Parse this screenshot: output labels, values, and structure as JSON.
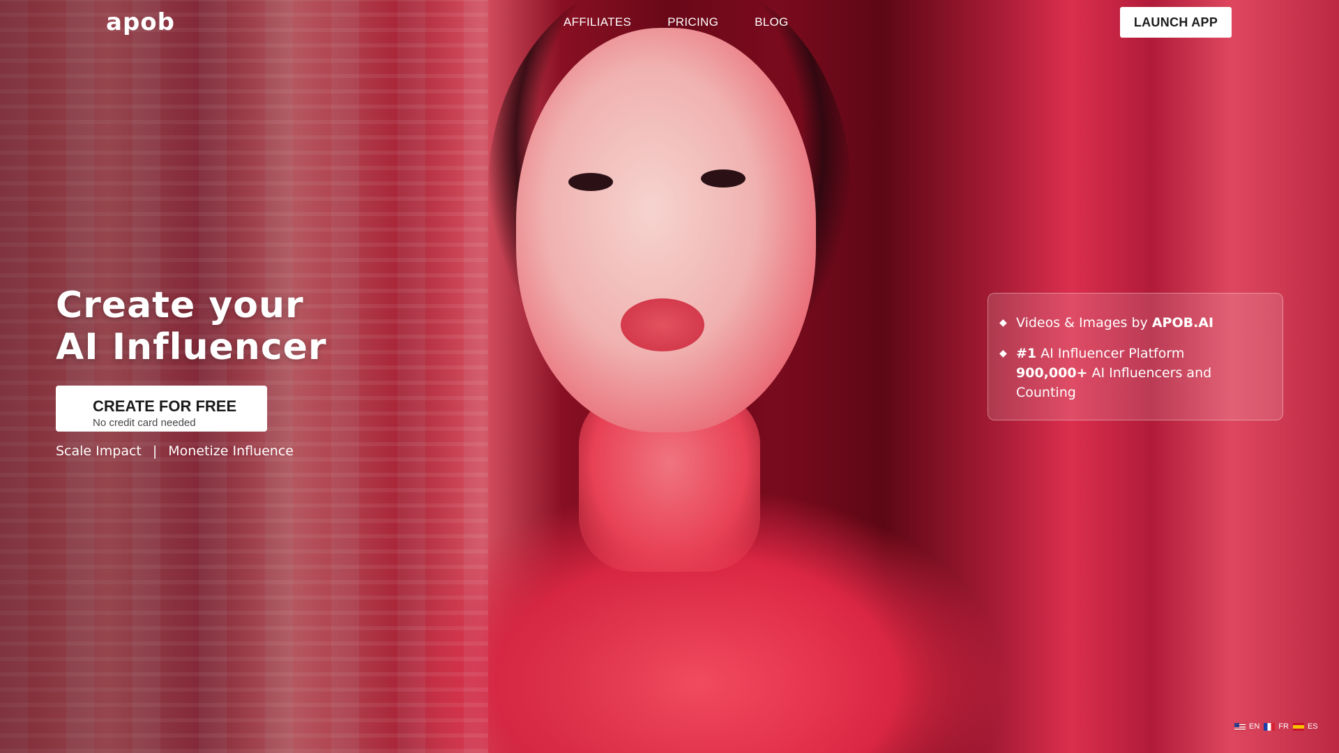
{
  "brand": {
    "logo_text": "apob"
  },
  "nav": {
    "items": [
      {
        "label": "AFFILIATES"
      },
      {
        "label": "PRICING"
      },
      {
        "label": "BLOG"
      }
    ],
    "launch_label": "LAUNCH APP"
  },
  "hero": {
    "title_line1": "Create your",
    "title_line2": "AI Influencer",
    "cta_label": "CREATE FOR FREE",
    "cta_sublabel": "No credit card needed",
    "tagline_left": "Scale Impact",
    "tagline_sep": "|",
    "tagline_right": "Monetize Influence"
  },
  "info_card": {
    "row1_text": "Videos & Images by ",
    "row1_bold": "APOB.AI",
    "row2_bold_rank": "#1",
    "row2_text": " AI Influencer Platform",
    "row3_bold": "900,000+",
    "row3_text": " AI Influencers and Counting"
  },
  "languages": [
    {
      "code": "EN",
      "flag": "us-flag-icon"
    },
    {
      "code": "FR",
      "flag": "fr-flag-icon"
    },
    {
      "code": "ES",
      "flag": "es-flag-icon"
    }
  ],
  "colors": {
    "background_red": "#c62a46",
    "button_bg": "#ffffff",
    "button_text": "#1b1b1b"
  }
}
